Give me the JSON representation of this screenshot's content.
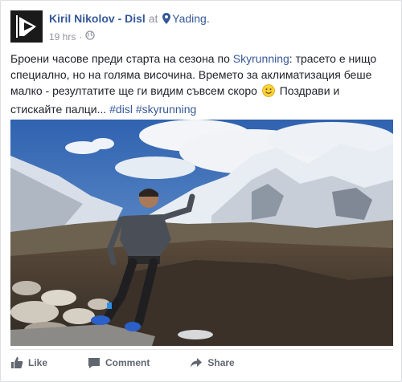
{
  "post": {
    "author": "Kiril Nikolov - Disl",
    "at_word": "at",
    "location": "Yading.",
    "time": "19 hrs",
    "dot": "·",
    "text_parts": {
      "t1": "Броени часове преди старта на сезона по ",
      "link1": "Skyrunning",
      "t2": ": трасето е нищо специално, но на голяма височина. Времето за аклиматизация беше малко - резултатите ще ги видим съвсем скоро ",
      "t3": " Поздрави и стискайте палци... ",
      "tag1": "#disl",
      "space": " ",
      "tag2": "#skyrunning"
    },
    "photo_alt": ""
  },
  "actions": {
    "like": "Like",
    "comment": "Comment",
    "share": "Share"
  },
  "icons": {
    "avatar": "disl-logo-icon",
    "pin": "location-pin-icon",
    "globe": "globe-icon",
    "smiley": "smiley-icon",
    "like": "thumbs-up-icon",
    "comment": "comment-bubble-icon",
    "share": "share-arrow-icon"
  },
  "colors": {
    "link": "#365899",
    "meta": "#90949c",
    "action": "#616770"
  }
}
